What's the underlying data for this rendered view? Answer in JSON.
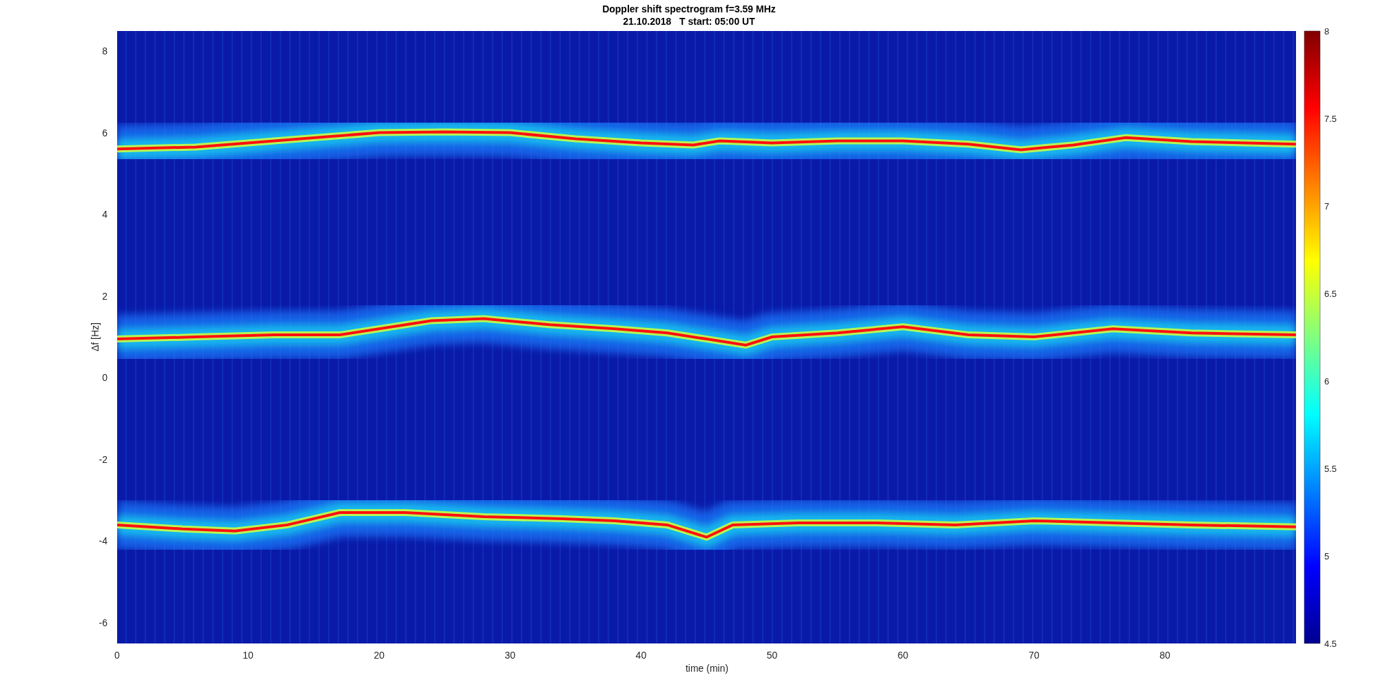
{
  "title": {
    "line_1": "Doppler shift spectrogram f=3.59 MHz",
    "line_2": "21.10.2018   T start: 05:00 UT"
  },
  "plot": {
    "ylabel": "Δf [Hz]",
    "xlabel": "time (min)",
    "yticks": [
      "8",
      "6",
      "4",
      "2",
      "0",
      "-2",
      "-4",
      "-6"
    ],
    "xticks": [
      "0",
      "10",
      "20",
      "30",
      "40",
      "50",
      "60",
      "70",
      "80"
    ]
  },
  "colorbar": {
    "ticks": [
      "8",
      "7.5",
      "7",
      "6.5",
      "6",
      "5.5",
      "5",
      "4.5"
    ]
  }
}
